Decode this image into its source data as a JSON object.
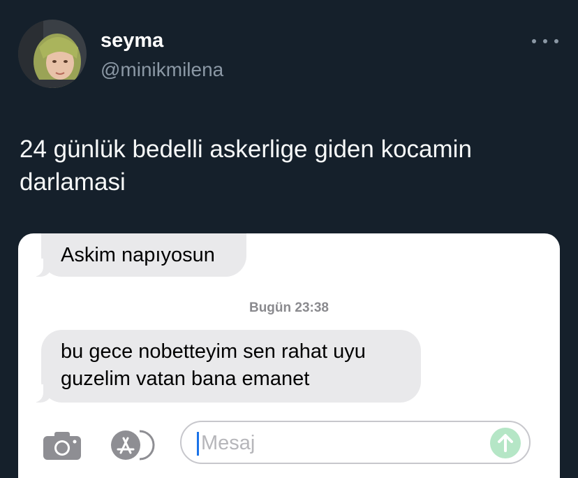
{
  "tweet": {
    "author": {
      "name": "seyma",
      "handle": "@minikmilena",
      "avatar_icon": "profile-avatar"
    },
    "more_icon": "ellipsis-icon",
    "text": "24 günlük bedelli askerlige giden kocamin darlamasi"
  },
  "screenshot": {
    "messages": [
      {
        "text": "Askim napıyosun"
      },
      {
        "text": "bu gece nobetteyim sen rahat uyu guzelim vatan bana emanet"
      }
    ],
    "timestamp": "Bugün 23:38",
    "input": {
      "placeholder": "Mesaj",
      "camera_icon": "camera-icon",
      "apps_icon": "app-store-icon",
      "send_icon": "send-arrow-icon"
    }
  },
  "colors": {
    "background": "#15202b",
    "bubble": "#e9e9eb",
    "send_button": "#b5e6c6",
    "handle": "#8b98a5"
  }
}
